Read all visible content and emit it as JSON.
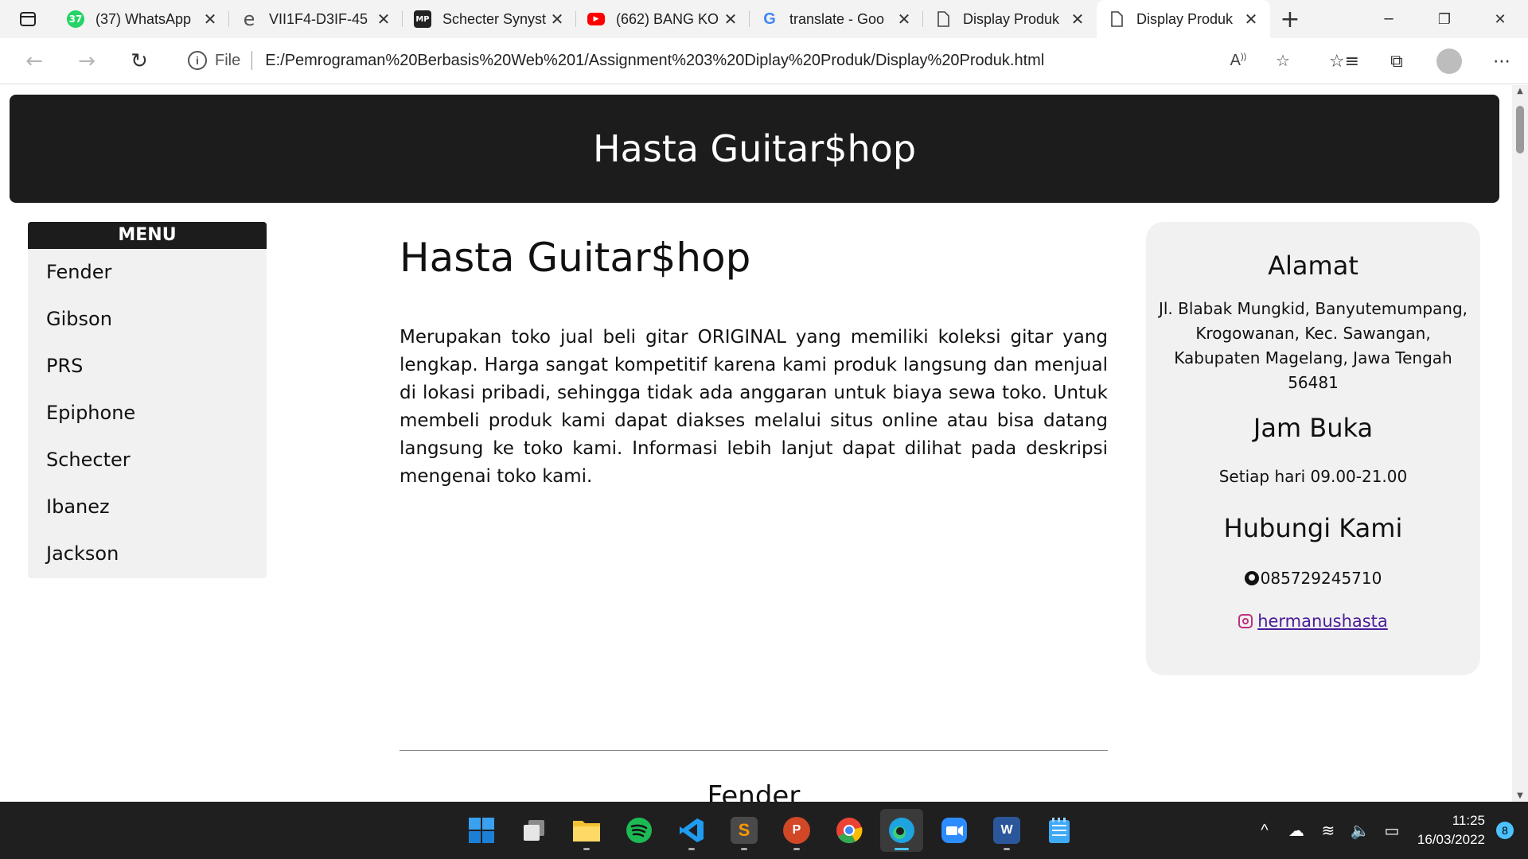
{
  "browser": {
    "tabs": [
      {
        "title": "(37) WhatsApp",
        "badge": "37",
        "icon": "whatsapp-icon",
        "color": "#25d366"
      },
      {
        "title": "VII1F4-D3IF-45",
        "icon": "internet-explorer-icon",
        "color": "#555555"
      },
      {
        "title": "Schecter Synyst",
        "icon": "musicplus-icon",
        "color": "#222222"
      },
      {
        "title": "(662) BANG KO",
        "icon": "youtube-icon",
        "color": "#ff0000"
      },
      {
        "title": "translate - Goo",
        "icon": "google-icon",
        "color": "#4285f4"
      },
      {
        "title": "Display Produk",
        "icon": "page-icon",
        "color": "#555555"
      },
      {
        "title": "Display Produk",
        "icon": "page-icon",
        "color": "#555555"
      }
    ],
    "address": {
      "scheme_label": "File",
      "url": "E:/Pemrograman%20Berbasis%20Web%201/Assignment%203%20Diplay%20Produk/Display%20Produk.html"
    }
  },
  "page": {
    "header_title": "Hasta Guitar$hop",
    "menu": {
      "title": "MENU",
      "items": [
        "Fender",
        "Gibson",
        "PRS",
        "Epiphone",
        "Schecter",
        "Ibanez",
        "Jackson"
      ]
    },
    "main": {
      "heading": "Hasta Guitar$hop",
      "description": "Merupakan toko jual beli gitar ORIGINAL yang memiliki koleksi gitar yang lengkap. Harga sangat kompetitif karena kami produk langsung dan menjual di lokasi pribadi, sehingga tidak ada anggaran untuk biaya sewa toko. Untuk membeli produk kami dapat diakses melalui situs online atau bisa datang langsung ke toko kami. Informasi lebih lanjut dapat dilihat pada deskripsi mengenai toko kami.",
      "section_title": "Fender"
    },
    "aside": {
      "address_title": "Alamat",
      "address": "Jl. Blabak Mungkid, Banyutemumpang, Krogowanan, Kec. Sawangan, Kabupaten Magelang, Jawa Tengah 56481",
      "hours_title": "Jam Buka",
      "hours": "Setiap hari 09.00-21.00",
      "contact_title": "Hubungi Kami",
      "phone": "085729245710",
      "instagram": "hermanushasta"
    }
  },
  "taskbar": {
    "apps": [
      {
        "name": "start-icon",
        "color": "#0078d4"
      },
      {
        "name": "task-view-icon",
        "color": "#cccccc"
      },
      {
        "name": "file-explorer-icon",
        "color": "#f2c233"
      },
      {
        "name": "spotify-icon",
        "color": "#1db954"
      },
      {
        "name": "vscode-icon",
        "color": "#007acc"
      },
      {
        "name": "sublime-text-icon",
        "color": "#ff9800"
      },
      {
        "name": "powerpoint-icon",
        "color": "#d24726"
      },
      {
        "name": "chrome-icon",
        "color": "#34a853"
      },
      {
        "name": "edge-icon",
        "color": "#1fa2e0"
      },
      {
        "name": "zoom-icon",
        "color": "#2d8cff"
      },
      {
        "name": "word-icon",
        "color": "#2b579a"
      },
      {
        "name": "notepad-icon",
        "color": "#3fa9f5"
      }
    ],
    "time": "11:25",
    "date": "16/03/2022",
    "notification_count": "8"
  }
}
